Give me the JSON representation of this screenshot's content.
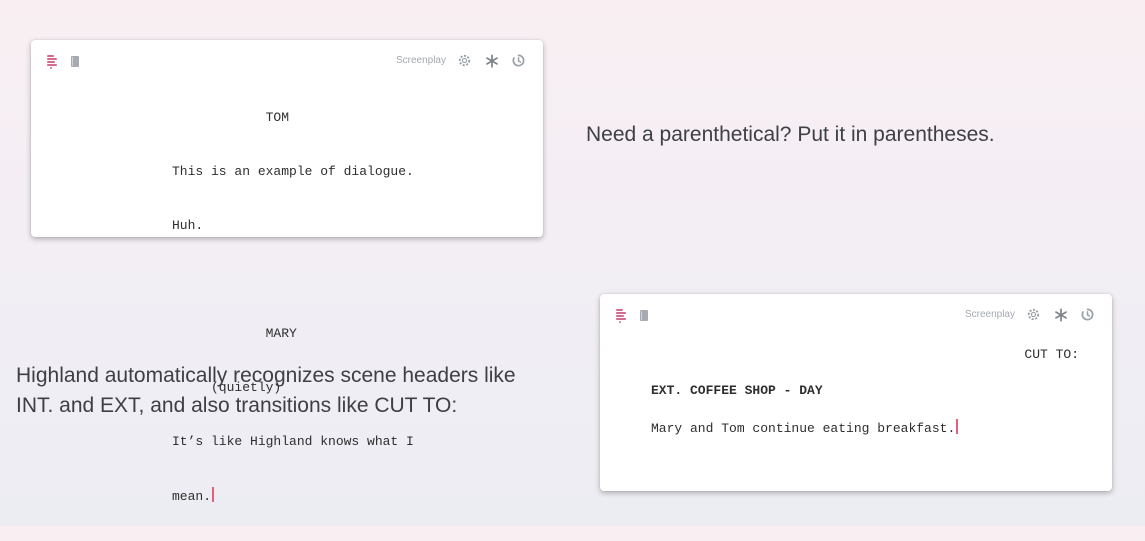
{
  "colors": {
    "accent": "#e06178",
    "icon_pink": "#d46a90",
    "muted": "#a4a9b0"
  },
  "card1": {
    "mode_label": "Screenplay",
    "icons": [
      "lines-icon",
      "book-icon",
      "gear-icon",
      "asterisk-icon",
      "timer-icon"
    ],
    "lines": [
      "            TOM",
      "This is an example of dialogue.",
      "Huh.",
      "",
      "            MARY",
      "     (quietly)",
      "It’s like Highland knows what I",
      "mean."
    ]
  },
  "card2": {
    "mode_label": "Screenplay",
    "icons": [
      "lines-icon",
      "book-icon",
      "gear-icon",
      "asterisk-icon",
      "timer-icon"
    ],
    "transition": "CUT TO:",
    "scene_header": "EXT. COFFEE SHOP - DAY",
    "action": "Mary and Tom continue eating breakfast."
  },
  "captions": {
    "parenthetical": "Need a parenthetical? Put it in parentheses.",
    "scene_headers_line1": "Highland automatically recognizes scene headers like",
    "scene_headers_line2": "INT. and EXT, and also transitions like CUT TO:"
  }
}
